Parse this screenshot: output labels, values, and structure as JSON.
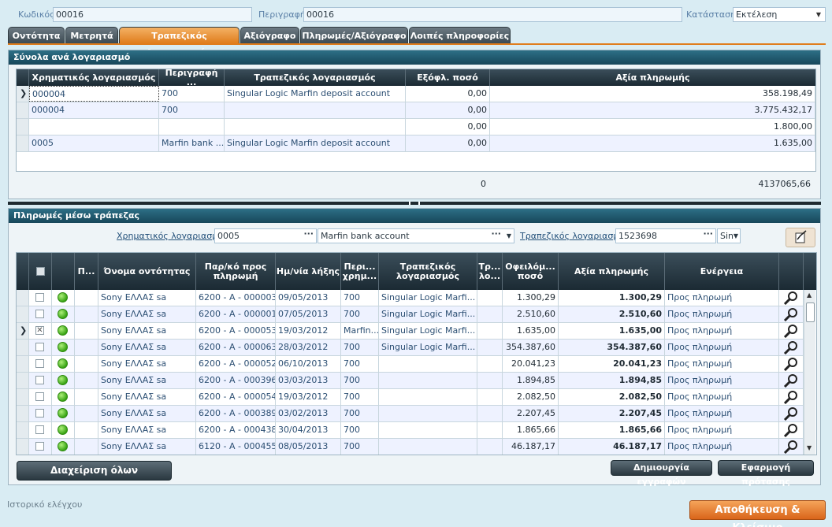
{
  "header": {
    "code_label": "Κωδικός",
    "code_value": "00016",
    "desc_label": "Περιγραφή",
    "desc_value": "00016",
    "status_label": "Κατάσταση",
    "status_value": "Εκτέλεση"
  },
  "tabs": [
    {
      "label": "Οντότητα"
    },
    {
      "label": "Μετρητά"
    },
    {
      "label": "Τραπεζικός λογαριασμός"
    },
    {
      "label": "Αξιόγραφο"
    },
    {
      "label": "Πληρωμές/Αξιόγραφο"
    },
    {
      "label": "Λοιπές πληροφορίες"
    }
  ],
  "totals_panel": {
    "title": "Σύνολα ανά λογαριασμό",
    "columns": [
      "Χρηματικός λογαριασμός",
      "Περιγραφή ...",
      "Τραπεζικός λογαριασμός",
      "Εξόφλ. ποσό",
      "Αξία πληρωμής"
    ],
    "rows": [
      {
        "account": "000004",
        "desc": "700",
        "bank": "Singular Logic Marfin deposit account",
        "paid": "0,00",
        "value": "358.198,49"
      },
      {
        "account": "000004",
        "desc": "700",
        "bank": "",
        "paid": "0,00",
        "value": "3.775.432,17"
      },
      {
        "account": "",
        "desc": "",
        "bank": "",
        "paid": "0,00",
        "value": "1.800,00"
      },
      {
        "account": "0005",
        "desc": "Marfin bank ...",
        "bank": "Singular Logic Marfin deposit account",
        "paid": "0,00",
        "value": "1.635,00"
      }
    ],
    "footer_paid": "0",
    "footer_value": "4137065,66"
  },
  "payments_panel": {
    "title": "Πληρωμές μέσω τράπεζας",
    "money_account_label": "Χρηματικός λογαριασμός",
    "money_account_code": "0005",
    "money_account_name": "Marfin bank account",
    "bank_account_label": "Τραπεζικός λογαριασμός",
    "bank_account_code": "1523698",
    "bank_account_extra": "Sin",
    "columns": [
      "",
      "",
      "Π...",
      "Όνομα οντότητας",
      "Παρ/κό προς πληρωμή",
      "Ημ/νία λήξης",
      "Περι... χρημ...",
      "Τραπεζικός λογαριασμός",
      "Τρ... λο...",
      "Οφειλόμ... ποσό",
      "Αξία πληρωμής",
      "Ενέργεια",
      ""
    ],
    "rows": [
      {
        "checked": false,
        "entity": "Sony ΕΛΛΑΣ sa",
        "doc": "6200 - A - 000003",
        "date": "09/05/2013",
        "desc": "700",
        "bank": "Singular Logic Marfi...",
        "owed": "1.300,29",
        "value": "1.300,29",
        "action": "Προς πληρωμή"
      },
      {
        "checked": false,
        "entity": "Sony ΕΛΛΑΣ sa",
        "doc": "6200 - A - 000001",
        "date": "07/05/2013",
        "desc": "700",
        "bank": "Singular Logic Marfi...",
        "owed": "2.510,60",
        "value": "2.510,60",
        "action": "Προς πληρωμή"
      },
      {
        "checked": true,
        "entity": "Sony ΕΛΛΑΣ sa",
        "doc": "6200 - A - 000053",
        "date": "19/03/2012",
        "desc": "Marfin...",
        "bank": "Singular Logic Marfi...",
        "owed": "1.635,00",
        "value": "1.635,00",
        "action": "Προς πληρωμή"
      },
      {
        "checked": false,
        "entity": "Sony ΕΛΛΑΣ sa",
        "doc": "6200 - A - 000063",
        "date": "28/03/2012",
        "desc": "700",
        "bank": "Singular Logic Marfi...",
        "owed": "354.387,60",
        "value": "354.387,60",
        "action": "Προς πληρωμή"
      },
      {
        "checked": false,
        "entity": "Sony ΕΛΛΑΣ sa",
        "doc": "6200 - A - 000052",
        "date": "06/10/2013",
        "desc": "700",
        "bank": "",
        "owed": "20.041,23",
        "value": "20.041,23",
        "action": "Προς πληρωμή"
      },
      {
        "checked": false,
        "entity": "Sony ΕΛΛΑΣ sa",
        "doc": "6200 - A - 000396",
        "date": "03/03/2013",
        "desc": "700",
        "bank": "",
        "owed": "1.894,85",
        "value": "1.894,85",
        "action": "Προς πληρωμή"
      },
      {
        "checked": false,
        "entity": "Sony ΕΛΛΑΣ sa",
        "doc": "6200 - A - 000054",
        "date": "19/03/2012",
        "desc": "700",
        "bank": "",
        "owed": "2.082,50",
        "value": "2.082,50",
        "action": "Προς πληρωμή"
      },
      {
        "checked": false,
        "entity": "Sony ΕΛΛΑΣ sa",
        "doc": "6200 - A - 000389",
        "date": "03/02/2013",
        "desc": "700",
        "bank": "",
        "owed": "2.207,45",
        "value": "2.207,45",
        "action": "Προς πληρωμή"
      },
      {
        "checked": false,
        "entity": "Sony ΕΛΛΑΣ sa",
        "doc": "6200 - A - 000438",
        "date": "30/04/2013",
        "desc": "700",
        "bank": "",
        "owed": "1.865,66",
        "value": "1.865,66",
        "action": "Προς πληρωμή"
      },
      {
        "checked": false,
        "entity": "Sony ΕΛΛΑΣ sa",
        "doc": "6120 - A - 000455",
        "date": "08/05/2013",
        "desc": "700",
        "bank": "",
        "owed": "46.187,17",
        "value": "46.187,17",
        "action": "Προς πληρωμή"
      }
    ],
    "manage_all_label": "Διαχείριση όλων",
    "create_records_label": "Δημιουργία εγγραφών",
    "apply_proposal_label": "Εφαρμογή πρότασης"
  },
  "footer": {
    "audit_label": "Ιστορικό ελέγχου",
    "save_close_label": "Αποθήκευση & Κλείσιμο"
  },
  "colors": {
    "accent_orange": "#e07d1c",
    "panel_header": "#17475a",
    "grid_header": "#1b2a33",
    "status_ok_green": "#3aa516"
  }
}
